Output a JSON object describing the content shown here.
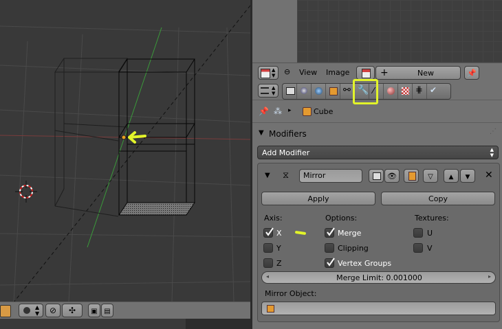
{
  "image_header": {
    "menu_view": "View",
    "menu_image": "Image",
    "new_label": "New"
  },
  "properties": {
    "breadcrumb_object": "Cube",
    "modifiers_header": "Modifiers",
    "add_modifier_label": "Add Modifier",
    "modifier": {
      "name": "Mirror",
      "apply_label": "Apply",
      "copy_label": "Copy",
      "axis_label": "Axis:",
      "options_label": "Options:",
      "textures_label": "Textures:",
      "axis_items": [
        {
          "label": "X",
          "checked": true
        },
        {
          "label": "Y",
          "checked": false
        },
        {
          "label": "Z",
          "checked": false
        }
      ],
      "option_items": [
        {
          "label": "Merge",
          "checked": true
        },
        {
          "label": "Clipping",
          "checked": false
        },
        {
          "label": "Vertex Groups",
          "checked": true
        }
      ],
      "texture_items": [
        {
          "label": "U",
          "checked": false
        },
        {
          "label": "V",
          "checked": false
        }
      ],
      "merge_limit_label": "Merge Limit: 0.001000",
      "mirror_object_label": "Mirror Object:"
    }
  },
  "colors": {
    "annotation": "#e2f42a",
    "panel_bg": "#727272",
    "viewport_bg": "#393939"
  }
}
